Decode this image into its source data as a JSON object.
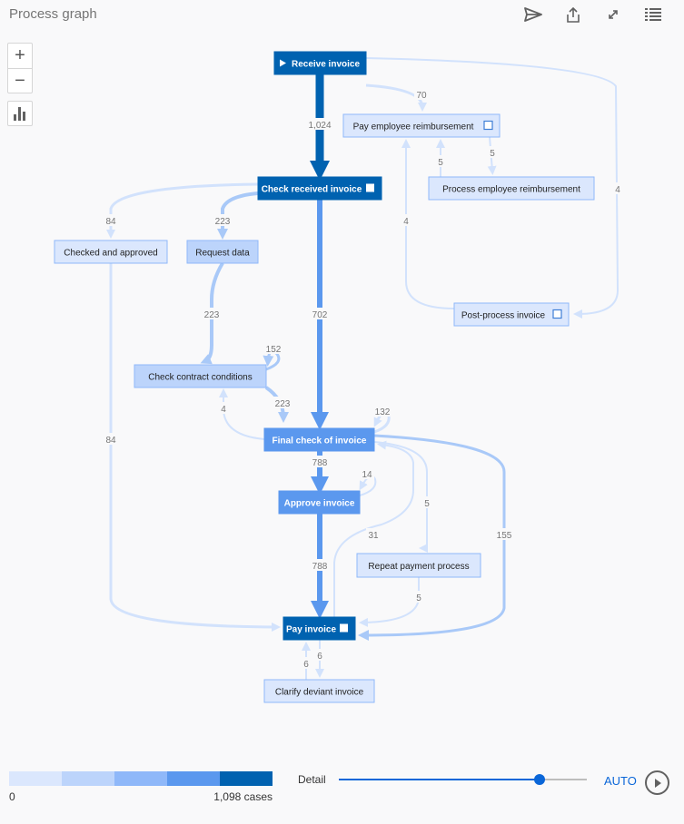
{
  "header": {
    "title": "Process graph",
    "icons": [
      "send-icon",
      "share-icon",
      "expand-icon",
      "list-icon"
    ]
  },
  "controls": {
    "zoom_in": "+",
    "zoom_out": "−",
    "stats_icon": "bar-chart-icon"
  },
  "colors": {
    "level1": "#dbe7fd",
    "level2": "#bcd4fb",
    "level3": "#8fb8f9",
    "level4": "#5b98ee",
    "level5": "#0062b0",
    "edge_light": "#d2e2fc",
    "edge_mid": "#a9c9f8",
    "edge_strong": "#5b98ee",
    "edge_dark": "#0062b0"
  },
  "graph": {
    "nodes": [
      {
        "id": "receive",
        "label": "Receive invoice",
        "level": 5,
        "start": true,
        "marker": false
      },
      {
        "id": "payemp",
        "label": "Pay employee reimbursement",
        "level": 1,
        "marker": "outline"
      },
      {
        "id": "check",
        "label": "Check received invoice",
        "level": 5,
        "marker": "filled"
      },
      {
        "id": "procemp",
        "label": "Process employee reimbursement",
        "level": 1,
        "marker": false
      },
      {
        "id": "checked",
        "label": "Checked and approved",
        "level": 1,
        "marker": false
      },
      {
        "id": "request",
        "label": "Request data",
        "level": 2,
        "marker": false
      },
      {
        "id": "postproc",
        "label": "Post-process invoice",
        "level": 1,
        "marker": "outline"
      },
      {
        "id": "contract",
        "label": "Check contract conditions",
        "level": 2,
        "marker": false
      },
      {
        "id": "final",
        "label": "Final check of invoice",
        "level": 4,
        "marker": false
      },
      {
        "id": "approve",
        "label": "Approve invoice",
        "level": 4,
        "marker": false
      },
      {
        "id": "repeat",
        "label": "Repeat payment process",
        "level": 1,
        "marker": false
      },
      {
        "id": "pay",
        "label": "Pay invoice",
        "level": 5,
        "marker": "filled"
      },
      {
        "id": "clarify",
        "label": "Clarify deviant invoice",
        "level": 1,
        "marker": false
      }
    ],
    "edges": [
      {
        "from": "receive",
        "to": "check",
        "count": "1,024"
      },
      {
        "from": "receive",
        "to": "payemp",
        "count": "70"
      },
      {
        "from": "receive",
        "to": "postproc",
        "count": "4"
      },
      {
        "from": "payemp",
        "to": "procemp",
        "count": "5"
      },
      {
        "from": "procemp",
        "to": "payemp",
        "count": "5"
      },
      {
        "from": "postproc",
        "to": "payemp",
        "count": "4"
      },
      {
        "from": "check",
        "to": "checked",
        "count": "84"
      },
      {
        "from": "check",
        "to": "request",
        "count": "223"
      },
      {
        "from": "check",
        "to": "final",
        "count": "702"
      },
      {
        "from": "request",
        "to": "contract",
        "count": "223"
      },
      {
        "from": "contract",
        "to": "contract",
        "count": "152"
      },
      {
        "from": "contract",
        "to": "final",
        "count": "223"
      },
      {
        "from": "final",
        "to": "contract",
        "count": "4"
      },
      {
        "from": "final",
        "to": "final",
        "count": "132"
      },
      {
        "from": "final",
        "to": "approve",
        "count": "788"
      },
      {
        "from": "approve",
        "to": "approve",
        "count": "14"
      },
      {
        "from": "approve",
        "to": "pay",
        "count": "788"
      },
      {
        "from": "pay",
        "to": "final",
        "count": "31"
      },
      {
        "from": "final",
        "to": "repeat",
        "count": "5"
      },
      {
        "from": "final",
        "to": "pay",
        "count": "155"
      },
      {
        "from": "repeat",
        "to": "pay",
        "count": "5"
      },
      {
        "from": "checked",
        "to": "pay",
        "count": "84"
      },
      {
        "from": "pay",
        "to": "clarify",
        "count": "6"
      },
      {
        "from": "clarify",
        "to": "pay",
        "count": "6"
      }
    ]
  },
  "legend": {
    "min_label": "0",
    "max_label": "1,098 cases"
  },
  "detail": {
    "label": "Detail",
    "value_fraction": 0.81
  },
  "auto_label": "AUTO",
  "play_icon": "play-icon"
}
